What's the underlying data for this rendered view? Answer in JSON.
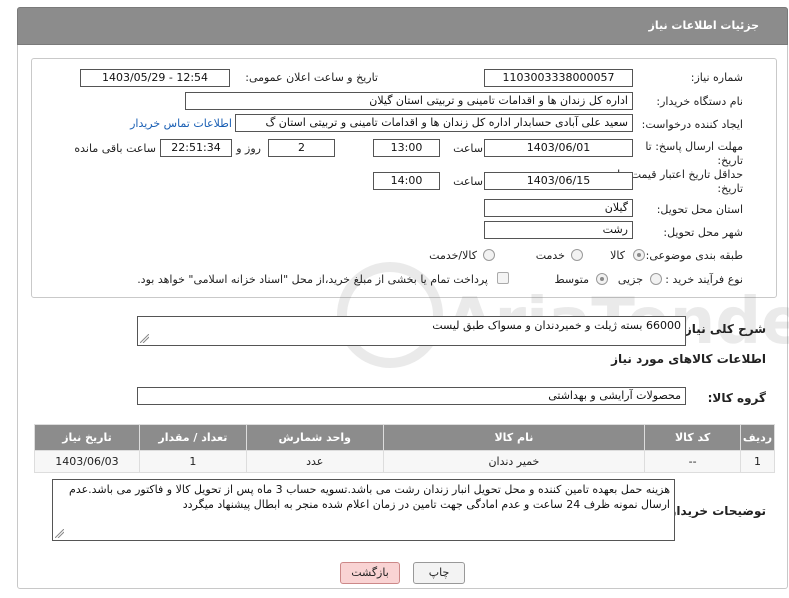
{
  "header": {
    "title": "جزئیات اطلاعات نیاز"
  },
  "form": {
    "need_number_label": "شماره نیاز:",
    "need_number": "1103003338000057",
    "announce_label": "تاریخ و ساعت اعلان عمومی:",
    "announce_value": "1403/05/29 - 12:54",
    "buyer_org_label": "نام دستگاه خریدار:",
    "buyer_org": "اداره کل زندان ها و اقدامات تامینی و تربیتی استان گیلان",
    "creator_label": "ایجاد کننده درخواست:",
    "creator": "سعید علی آبادی حسابدار اداره کل زندان ها و اقدامات تامینی و تربیتی استان گ",
    "contact_link": "اطلاعات تماس خریدار",
    "reply_deadline_label": "مهلت ارسال پاسخ: تا تاریخ:",
    "reply_date": "1403/06/01",
    "time_label": "ساعت",
    "reply_time": "13:00",
    "days": "2",
    "days_label": "روز و",
    "remaining_time": "22:51:34",
    "remaining_label": "ساعت باقی مانده",
    "validity_label": "حداقل تاریخ اعتبار قیمت: تا تاریخ:",
    "validity_date": "1403/06/15",
    "validity_time": "14:00",
    "province_label": "استان محل تحویل:",
    "province": "گیلان",
    "city_label": "شهر محل تحویل:",
    "city": "رشت",
    "category_label": "طبقه بندی موضوعی:",
    "category_options": [
      "کالا",
      "خدمت",
      "کالا/خدمت"
    ],
    "process_label": "نوع فرآیند خرید :",
    "process_options": [
      "جزیی",
      "متوسط"
    ],
    "payment_note": "پرداخت تمام یا بخشی از مبلغ خرید،از محل \"اسناد خزانه اسلامی\" خواهد بود."
  },
  "description": {
    "label": "شرح کلی نیاز:",
    "value": "66000 بسته ژیلت و خمیردندان و مسواک طبق لیست"
  },
  "goods_info": {
    "title": "اطلاعات کالاهای مورد نیاز",
    "group_label": "گروه کالا:",
    "group_value": "محصولات آرایشی و بهداشتی"
  },
  "table": {
    "headers": [
      "ردیف",
      "کد کالا",
      "نام کالا",
      "واحد شمارش",
      "تعداد / مقدار",
      "تاریخ نیاز"
    ],
    "rows": [
      [
        "1",
        "--",
        "خمیر دندان",
        "عدد",
        "1",
        "1403/06/03"
      ]
    ]
  },
  "buyer_notes": {
    "label": "توضیحات خریدار:",
    "value": "هزینه حمل بعهده تامین کننده و محل تحویل انبار زندان رشت می باشد.تسویه حساب 3 ماه پس از تحویل کالا و فاکتور می باشد.عدم ارسال نمونه ظرف 24 ساعت و عدم امادگی جهت تامین در زمان اعلام شده منجر به ابطال پیشنهاد میگردد"
  },
  "buttons": {
    "print": "چاپ",
    "back": "بازگشت"
  },
  "watermark": {
    "text": "AriaTender.net"
  },
  "colors": {
    "header": "#8c8c8c",
    "link": "#1a5fb4",
    "back_button": "#f9d3d3",
    "print_button": "#f3f3f3"
  }
}
